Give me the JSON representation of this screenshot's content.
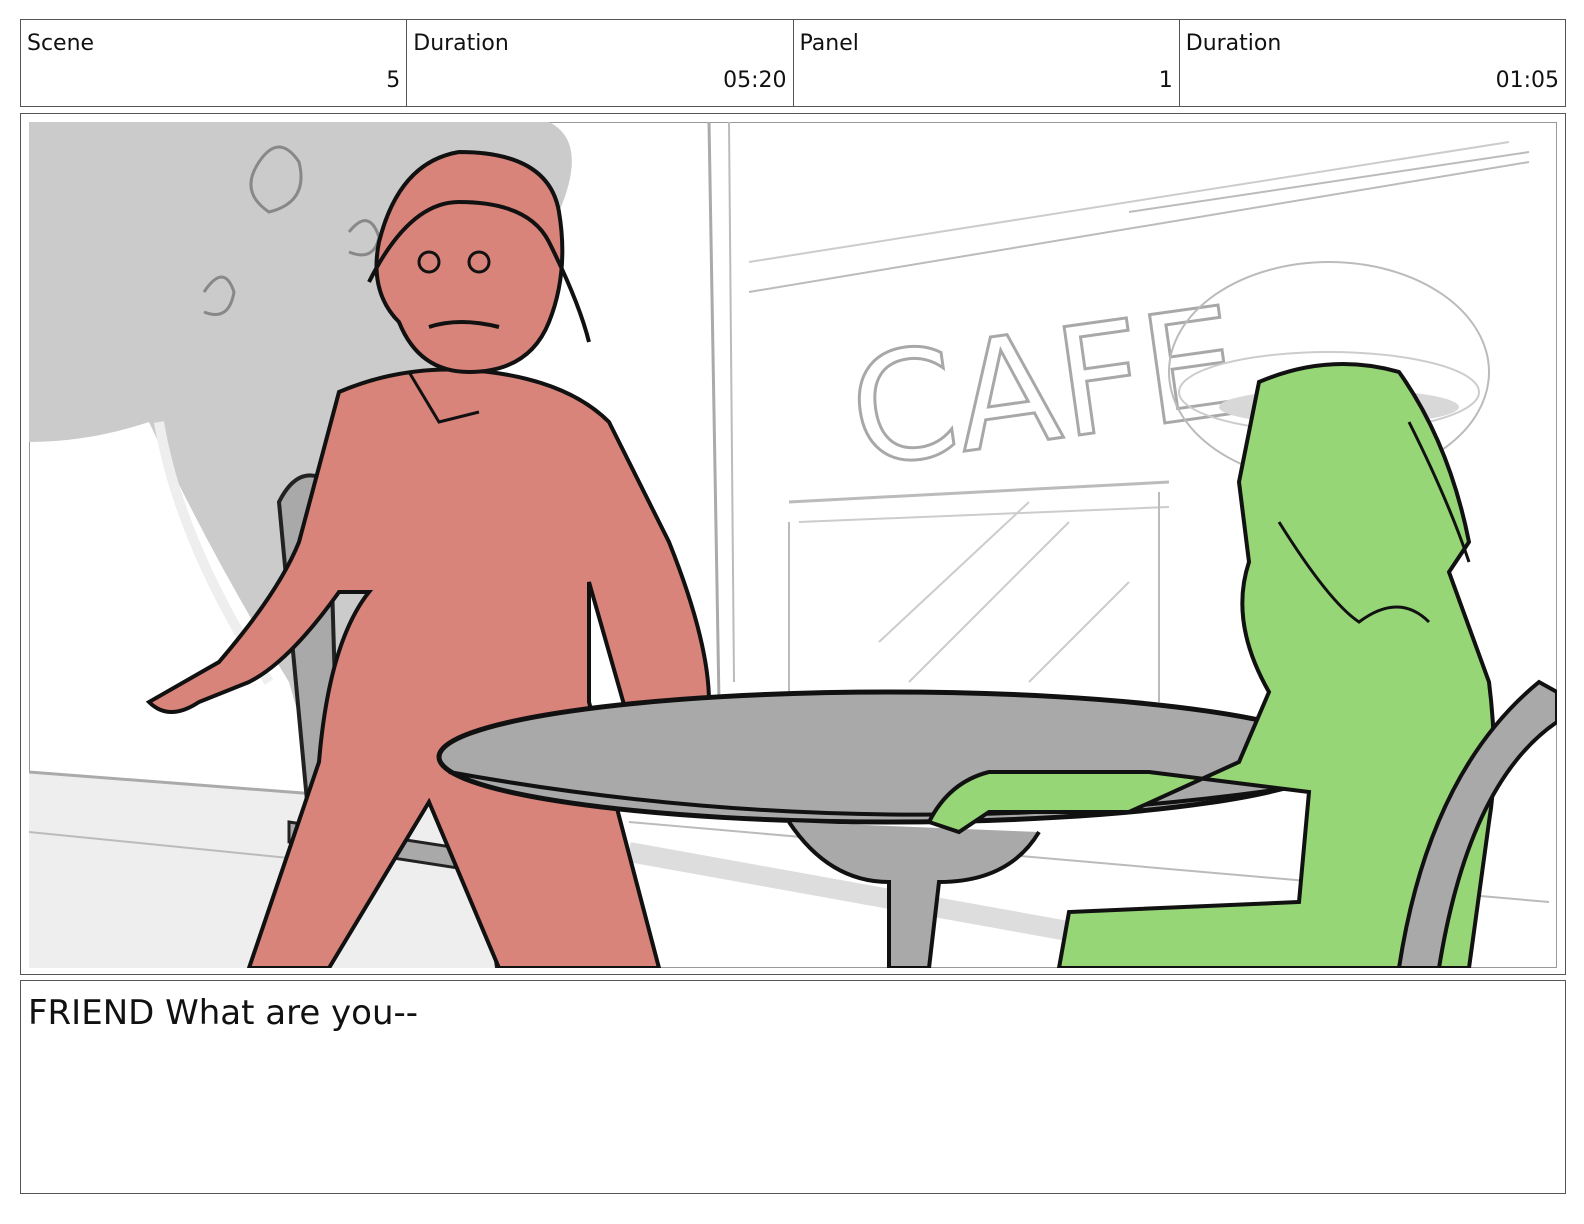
{
  "header": {
    "scene_label": "Scene",
    "scene_value": "5",
    "scene_duration_label": "Duration",
    "scene_duration_value": "05:20",
    "panel_label": "Panel",
    "panel_value": "1",
    "panel_duration_label": "Duration",
    "panel_duration_value": "01:05"
  },
  "artwork": {
    "sign_text": "CAFE",
    "colors": {
      "left_character": "#d9847a",
      "right_character": "#96d676",
      "furniture": "#a9a9a9",
      "background_tree": "#cbcbcb",
      "ink": "#111111"
    }
  },
  "notes": {
    "text": "FRIEND What are you--"
  }
}
